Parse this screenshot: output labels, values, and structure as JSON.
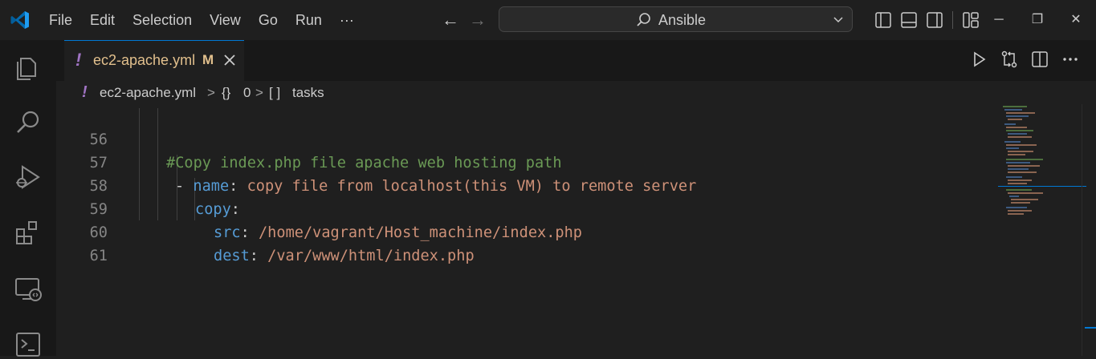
{
  "menu": [
    "File",
    "Edit",
    "Selection",
    "View",
    "Go",
    "Run",
    "···"
  ],
  "nav": {
    "back": "←",
    "forward": "→"
  },
  "command_center": {
    "label": "Ansible"
  },
  "window_controls": {
    "minimize": "─",
    "restore": "❐",
    "close": "✕"
  },
  "tab": {
    "mark": "!",
    "name": "ec2-apache.yml",
    "modified": "M"
  },
  "breadcrumb": {
    "mark": "!",
    "file": "ec2-apache.yml",
    "sep1": ">",
    "obj_icon": "{}",
    "obj": "0",
    "sep2": ">",
    "arr_icon": "[ ]",
    "arr": "tasks"
  },
  "lines": [
    {
      "num": "56",
      "text": "#Copy index.php file apache web hosting path"
    },
    {
      "num": "57",
      "dash": "- ",
      "key": "name",
      "colon": ": ",
      "value": "copy file from localhost(this VM) to remote server"
    },
    {
      "num": "58",
      "key": "copy",
      "colon": ":"
    },
    {
      "num": "59",
      "key": "src",
      "colon": ": ",
      "value": "/home/vagrant/Host_machine/index.php"
    },
    {
      "num": "60",
      "key": "dest",
      "colon": ": ",
      "value": "/var/www/html/index.php"
    },
    {
      "num": "61"
    }
  ],
  "colors": {
    "accent": "#0078d4",
    "comment": "#6a9955",
    "key": "#569cd6",
    "string": "#ce9178",
    "modified": "#e2c08d",
    "yaml_icon": "#a074c4"
  }
}
